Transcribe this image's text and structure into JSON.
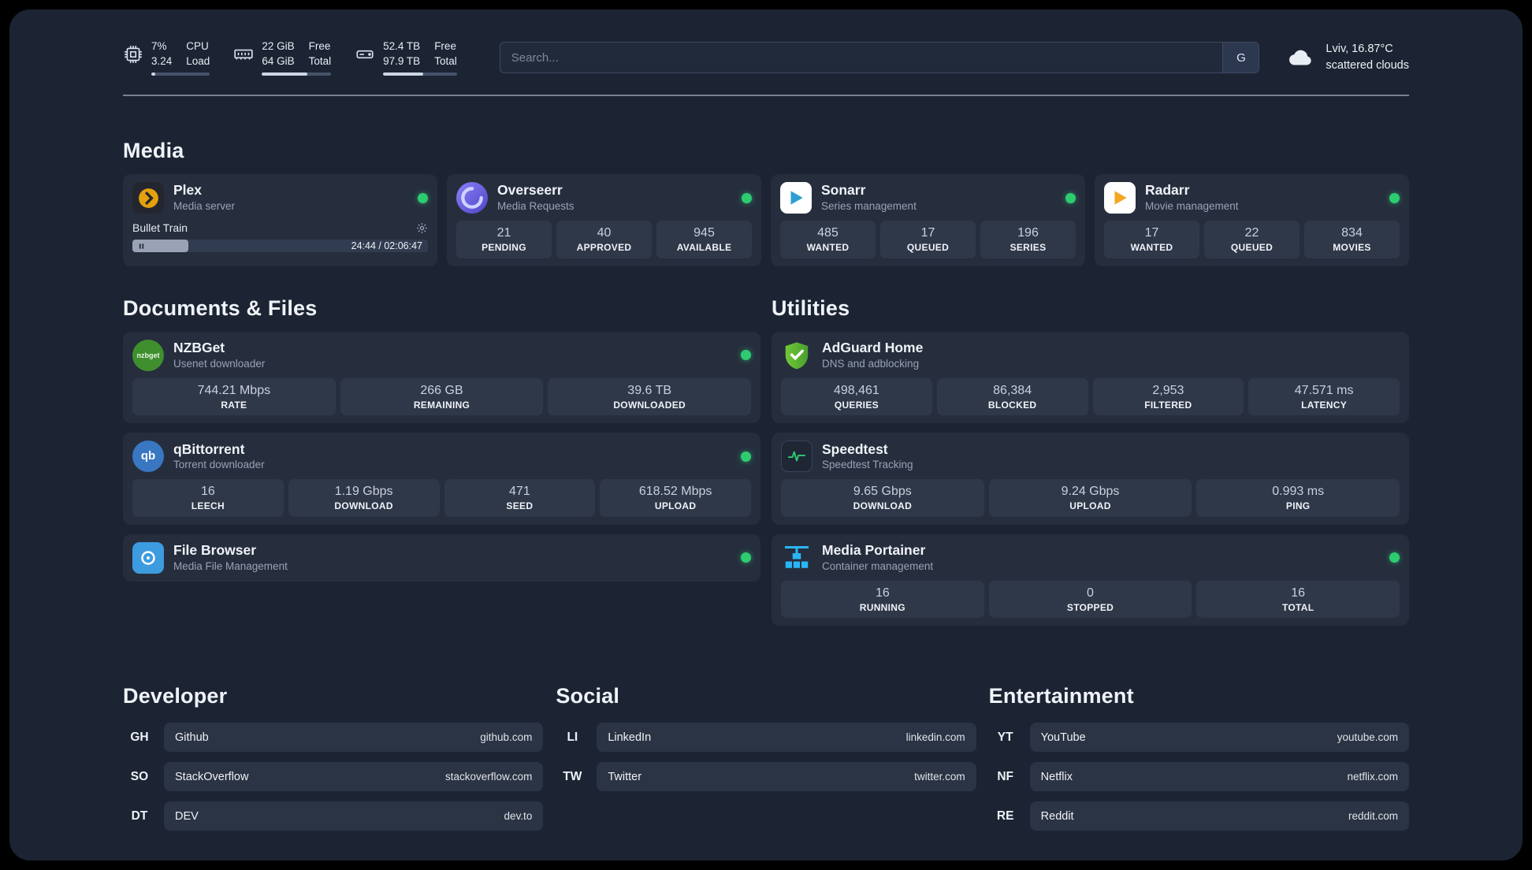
{
  "topbar": {
    "cpu": {
      "value": "7%",
      "sub": "3.24",
      "labelTop": "CPU",
      "labelBottom": "Load",
      "progress": 7
    },
    "ram": {
      "value": "22 GiB",
      "sub": "64 GiB",
      "labelTop": "Free",
      "labelBottom": "Total",
      "progress": 66
    },
    "disk": {
      "value": "52.4 TB",
      "sub": "97.9 TB",
      "labelTop": "Free",
      "labelBottom": "Total",
      "progress": 54
    },
    "search": {
      "placeholder": "Search...",
      "engine_label": "G"
    },
    "weather": {
      "location": "Lviv, 16.87°C",
      "condition": "scattered clouds"
    }
  },
  "sections": {
    "media": {
      "title": "Media",
      "plex": {
        "name": "Plex",
        "desc": "Media server",
        "player": {
          "track": "Bullet Train",
          "time": "24:44 / 02:06:47",
          "progress": 19
        }
      },
      "overseerr": {
        "name": "Overseerr",
        "desc": "Media Requests",
        "stats": [
          {
            "value": "21",
            "label": "PENDING"
          },
          {
            "value": "40",
            "label": "APPROVED"
          },
          {
            "value": "945",
            "label": "AVAILABLE"
          }
        ]
      },
      "sonarr": {
        "name": "Sonarr",
        "desc": "Series management",
        "stats": [
          {
            "value": "485",
            "label": "WANTED"
          },
          {
            "value": "17",
            "label": "QUEUED"
          },
          {
            "value": "196",
            "label": "SERIES"
          }
        ]
      },
      "radarr": {
        "name": "Radarr",
        "desc": "Movie management",
        "stats": [
          {
            "value": "17",
            "label": "WANTED"
          },
          {
            "value": "22",
            "label": "QUEUED"
          },
          {
            "value": "834",
            "label": "MOVIES"
          }
        ]
      }
    },
    "documents": {
      "title": "Documents & Files",
      "nzbget": {
        "name": "NZBGet",
        "desc": "Usenet downloader",
        "icon_text": "nzbget",
        "stats": [
          {
            "value": "744.21 Mbps",
            "label": "RATE"
          },
          {
            "value": "266 GB",
            "label": "REMAINING"
          },
          {
            "value": "39.6 TB",
            "label": "DOWNLOADED"
          }
        ]
      },
      "qbittorrent": {
        "name": "qBittorrent",
        "desc": "Torrent downloader",
        "icon_text": "qb",
        "stats": [
          {
            "value": "16",
            "label": "LEECH"
          },
          {
            "value": "1.19 Gbps",
            "label": "DOWNLOAD"
          },
          {
            "value": "471",
            "label": "SEED"
          },
          {
            "value": "618.52 Mbps",
            "label": "UPLOAD"
          }
        ]
      },
      "filebrowser": {
        "name": "File Browser",
        "desc": "Media File Management"
      }
    },
    "utilities": {
      "title": "Utilities",
      "adguard": {
        "name": "AdGuard Home",
        "desc": "DNS and adblocking",
        "stats": [
          {
            "value": "498,461",
            "label": "QUERIES"
          },
          {
            "value": "86,384",
            "label": "BLOCKED"
          },
          {
            "value": "2,953",
            "label": "FILTERED"
          },
          {
            "value": "47.571 ms",
            "label": "LATENCY"
          }
        ]
      },
      "speedtest": {
        "name": "Speedtest",
        "desc": "Speedtest Tracking",
        "stats": [
          {
            "value": "9.65 Gbps",
            "label": "DOWNLOAD"
          },
          {
            "value": "9.24 Gbps",
            "label": "UPLOAD"
          },
          {
            "value": "0.993 ms",
            "label": "PING"
          }
        ]
      },
      "portainer": {
        "name": "Media Portainer",
        "desc": "Container management",
        "stats": [
          {
            "value": "16",
            "label": "RUNNING"
          },
          {
            "value": "0",
            "label": "STOPPED"
          },
          {
            "value": "16",
            "label": "TOTAL"
          }
        ]
      }
    }
  },
  "bookmarks": {
    "developer": {
      "title": "Developer",
      "items": [
        {
          "abbr": "GH",
          "name": "Github",
          "url": "github.com"
        },
        {
          "abbr": "SO",
          "name": "StackOverflow",
          "url": "stackoverflow.com"
        },
        {
          "abbr": "DT",
          "name": "DEV",
          "url": "dev.to"
        }
      ]
    },
    "social": {
      "title": "Social",
      "items": [
        {
          "abbr": "LI",
          "name": "LinkedIn",
          "url": "linkedin.com"
        },
        {
          "abbr": "TW",
          "name": "Twitter",
          "url": "twitter.com"
        }
      ]
    },
    "entertainment": {
      "title": "Entertainment",
      "items": [
        {
          "abbr": "YT",
          "name": "YouTube",
          "url": "youtube.com"
        },
        {
          "abbr": "NF",
          "name": "Netflix",
          "url": "netflix.com"
        },
        {
          "abbr": "RE",
          "name": "Reddit",
          "url": "reddit.com"
        }
      ]
    }
  },
  "colors": {
    "status_online": "#2ecc71",
    "accent_cloud": "#e9edf4"
  }
}
